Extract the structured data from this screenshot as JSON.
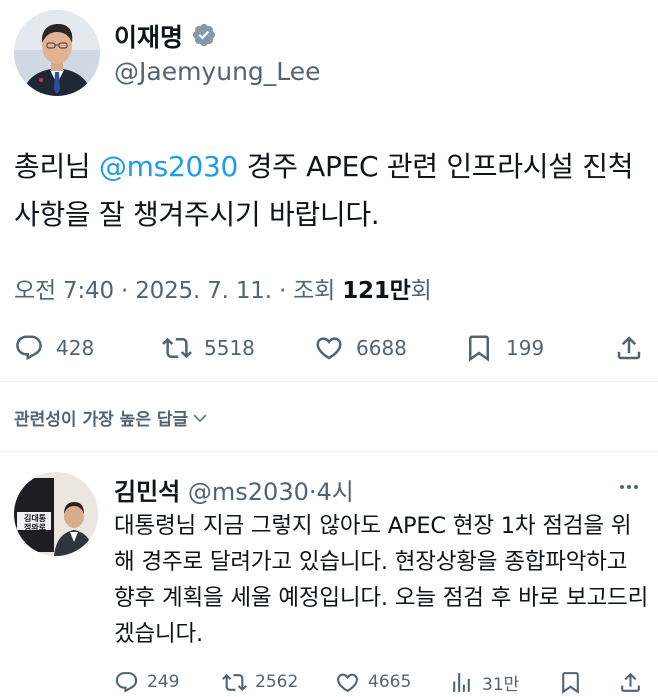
{
  "tweet": {
    "author_name": "이재명",
    "author_handle": "@Jaemyung_Lee",
    "text_before": "총리님 ",
    "mention": "@ms2030",
    "text_after": " 경주 APEC 관련 인프라시설 진척사항을 잘 챙겨주시기 바랍니다.",
    "time": "오전 7:40",
    "date": "2025. 7. 11.",
    "views_label": "조회",
    "views_number": "121만",
    "views_suffix": "회",
    "stats": {
      "replies": "428",
      "retweets": "5518",
      "likes": "6688",
      "bookmarks": "199"
    }
  },
  "replies_section": {
    "sort_label": "관련성이 가장 높은 답글"
  },
  "reply": {
    "author_name": "김민석",
    "author_handle": "@ms2030",
    "time": "4시",
    "text": "대통령님 지금 그렇지 않아도 APEC 현장 1차 점검을 위해 경주로 달려가고 있습니다. 현장상황을 종합파악하고 향후 계획을 세울 예정입니다. 오늘 점검 후 바로 보고드리겠습니다.",
    "avatar_sign_text": "김대통 정와로",
    "stats": {
      "replies": "249",
      "retweets": "2562",
      "likes": "4665",
      "views": "31만"
    }
  },
  "colors": {
    "text": "#0f1419",
    "secondary": "#536471",
    "accent": "#1d9bf0",
    "verified_badge": "#829aab"
  },
  "icons": [
    "verified-badge-icon",
    "reply-icon",
    "retweet-icon",
    "like-icon",
    "bookmark-icon",
    "share-icon",
    "chevron-down-icon",
    "more-icon",
    "views-icon"
  ]
}
